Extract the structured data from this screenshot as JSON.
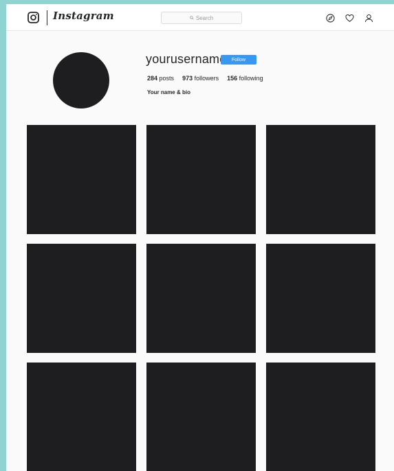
{
  "header": {
    "brand": "Instagram",
    "search_placeholder": "Search",
    "icons": [
      "instagram-logo-icon",
      "search-icon",
      "compass-icon",
      "heart-icon",
      "user-icon"
    ]
  },
  "profile": {
    "username": "yourusername",
    "follow_label": "Follow",
    "posts_count": "284",
    "posts_label": "posts",
    "followers_count": "973",
    "followers_label": "followers",
    "following_count": "156",
    "following_label": "following",
    "bio": "Your name & bio"
  },
  "posts": [
    {
      "id": 1
    },
    {
      "id": 2
    },
    {
      "id": 3
    },
    {
      "id": 4
    },
    {
      "id": 5
    },
    {
      "id": 6
    },
    {
      "id": 7
    },
    {
      "id": 8
    },
    {
      "id": 9
    }
  ],
  "colors": {
    "outer_border": "#8fd3d3",
    "page_background": "#fafafa",
    "follow_button": "#3897f0",
    "placeholder_dark": "#1e1e20"
  }
}
